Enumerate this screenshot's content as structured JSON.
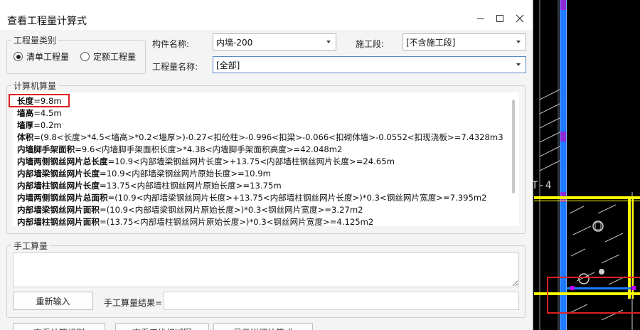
{
  "dialog": {
    "title": "查看工程量计算式",
    "quantity_type": {
      "legend": "工程量类别",
      "options": [
        "清单工程量",
        "定额工程量"
      ],
      "selected": "清单工程量"
    },
    "component_name_label": "构件名称:",
    "component_name_value": "内墙-200",
    "construction_section_label": "施工段:",
    "construction_section_value": "[不含施工段]",
    "quantity_name_label": "工程量名称:",
    "quantity_name_value": "[全部]",
    "computed": {
      "legend": "计算机算量",
      "lines": [
        {
          "name": "长度",
          "expr": "=9.8m"
        },
        {
          "name": "墙高",
          "expr": "=4.5m"
        },
        {
          "name": "墙厚",
          "expr": "=0.2m"
        },
        {
          "name": "体积",
          "expr": "=(9.8<长度>*4.5<墙高>*0.2<墙厚>)-0.27<扣砼柱>-0.996<扣梁>-0.066<扣砌体墙>-0.0552<扣现浇板>=7.4328m3"
        },
        {
          "name": "内墙脚手架面积",
          "expr": "=9.6<内墙脚手架面积长度>*4.38<内墙脚手架面积高度>=42.048m2"
        },
        {
          "name": "内墙两侧钢丝网片总长度",
          "expr": "=10.9<内部墙梁钢丝网片长度>+13.75<内部墙柱钢丝网片长度>=24.65m"
        },
        {
          "name": "内部墙梁钢丝网片长度",
          "expr": "=10.9<内部墙梁钢丝网片原始长度>=10.9m"
        },
        {
          "name": "内部墙柱钢丝网片长度",
          "expr": "=13.75<内部墙柱钢丝网片原始长度>=13.75m"
        },
        {
          "name": "内墙两侧钢丝网片总面积",
          "expr": "=(10.9<内部墙梁钢丝网片长度>+13.75<内部墙柱钢丝网片长度>)*0.3<钢丝网片宽度>=7.395m2"
        },
        {
          "name": "内部墙梁钢丝网片面积",
          "expr": "=(10.9<内部墙梁钢丝网片原始长度>)*0.3<钢丝网片宽度>=3.27m2"
        },
        {
          "name": "内部墙柱钢丝网片面积",
          "expr": "=(13.75<内部墙柱钢丝网片原始长度>)*0.3<钢丝网片宽度>=4.125m2"
        }
      ]
    },
    "manual": {
      "legend": "手工算量",
      "reinput_button": "重新输入",
      "result_label": "手工算量结果=",
      "result_value": ""
    },
    "bottom_buttons": [
      "查看计算规则",
      "查看三维扣减图",
      "显示详细计算式"
    ]
  },
  "cad": {
    "axis_label": "T-4"
  },
  "colors": {
    "highlight": "#e02020",
    "cad_blue": "#1e7bff",
    "cad_yellow": "#ffff00",
    "cad_magenta": "#c000ff"
  }
}
